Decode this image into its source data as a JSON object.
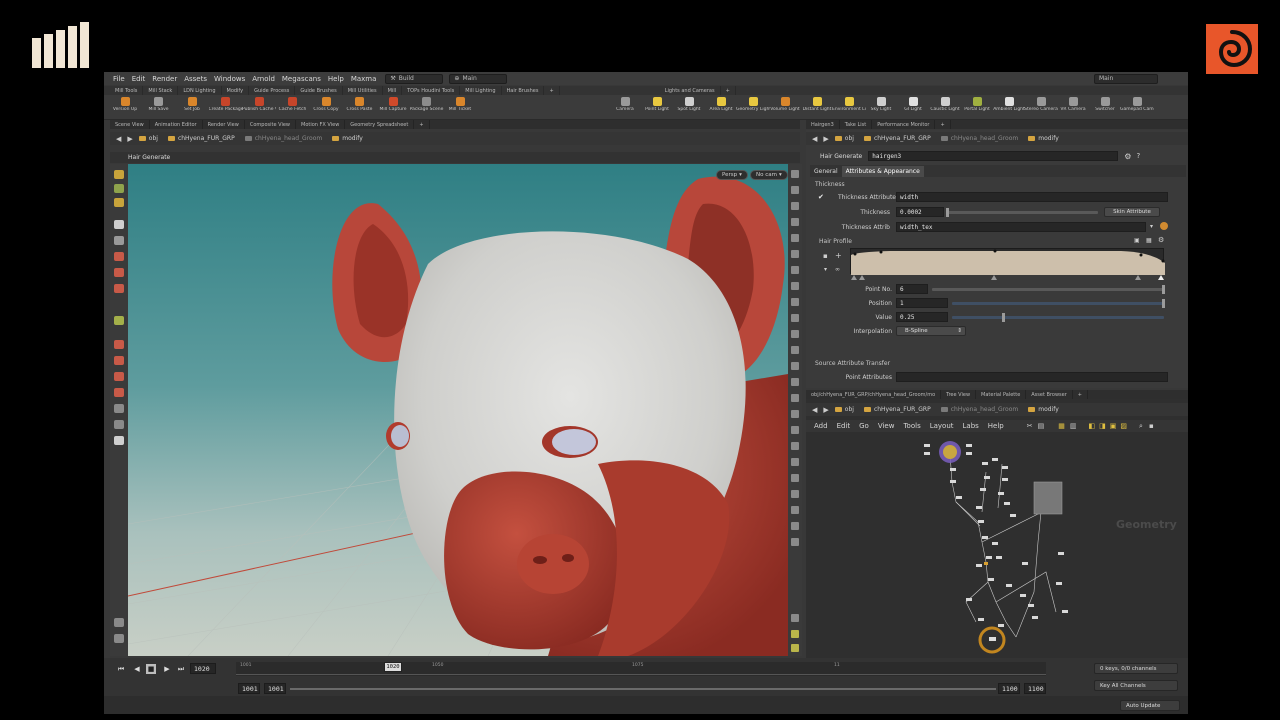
{
  "menubar": {
    "items": [
      "File",
      "Edit",
      "Render",
      "Assets",
      "Windows",
      "Arnold",
      "Megascans",
      "Help",
      "Maxma"
    ],
    "build_label": "Build",
    "desk_label": "Main",
    "right_desk": "Main"
  },
  "shelf_tabs": [
    "Mill Tools",
    "Mill Stack",
    "LDN Lighting",
    "Modify",
    "Guide Process",
    "Guide Brushes",
    "Mill Utilities",
    "Mill",
    "TOPs Houdini Tools",
    "Mill Lighting",
    "Hair Brushes"
  ],
  "lights_tab": "Lights and Cameras",
  "left_tools": [
    {
      "label": "Version Up",
      "color": "#d9862b"
    },
    {
      "label": "Mill Save",
      "color": "#9a9a9a"
    },
    {
      "label": "Set Job",
      "color": "#d9862b"
    },
    {
      "label": "Create Package",
      "color": "#c7452a"
    },
    {
      "label": "Publish Cache Version",
      "color": "#c7452a"
    },
    {
      "label": "Cache Fetch",
      "color": "#c7452a"
    },
    {
      "label": "Cross Copy",
      "color": "#d9862b"
    },
    {
      "label": "Cross Paste",
      "color": "#d9862b"
    },
    {
      "label": "Mill Capture",
      "color": "#d14a2a"
    },
    {
      "label": "Package Scene",
      "color": "#8c8c8c"
    },
    {
      "label": "Mill Ticket",
      "color": "#d9862b"
    }
  ],
  "light_tools": [
    {
      "label": "Camera",
      "color": "#9a9a9a"
    },
    {
      "label": "Point Light",
      "color": "#e8c840"
    },
    {
      "label": "Spot Light",
      "color": "#cfcfcf"
    },
    {
      "label": "Area Light",
      "color": "#e8c840"
    },
    {
      "label": "Geometry Light",
      "color": "#e8c840"
    },
    {
      "label": "Volume Light",
      "color": "#d9862b"
    },
    {
      "label": "Distant Light",
      "color": "#e8c840"
    },
    {
      "label": "Environment Light",
      "color": "#e8c840"
    },
    {
      "label": "Sky Light",
      "color": "#cfcfcf"
    },
    {
      "label": "GI Light",
      "color": "#e0e0e0"
    },
    {
      "label": "Caustic Light",
      "color": "#cfcfcf"
    },
    {
      "label": "Portal Light",
      "color": "#a0b040"
    },
    {
      "label": "Ambient Light",
      "color": "#e0e0e0"
    },
    {
      "label": "Stereo Camera",
      "color": "#9a9a9a"
    },
    {
      "label": "VR Camera",
      "color": "#9a9a9a"
    },
    {
      "label": "Switcher",
      "color": "#9a9a9a"
    },
    {
      "label": "Gamepad Camera",
      "color": "#9a9a9a"
    }
  ],
  "left_pane_tabs": [
    "Scene View",
    "Animation Editor",
    "Render View",
    "Composite View",
    "Motion FX View",
    "Geometry Spreadsheet"
  ],
  "right_pane_tabs": [
    "Hairgen3",
    "Take List",
    "Performance Monitor"
  ],
  "path": {
    "obj": "obj",
    "fur": "chHyena_FUR_GRP",
    "groom": "chHyena_head_Groom",
    "modify": "modify"
  },
  "viewport": {
    "title": "Hair Generate",
    "persp": "Persp",
    "cam": "No cam"
  },
  "params": {
    "node_type": "Hair Generate",
    "node_name": "hairgen3",
    "tabs": [
      "General",
      "Attributes & Appearance"
    ],
    "section_thickness": "Thickness",
    "thickness_attr_label": "Thickness Attribute",
    "thickness_attr_value": "width",
    "thickness_label": "Thickness",
    "thickness_value": "0.0002",
    "skin_attr_btn": "Skin Attribute",
    "thickness_attrib_label": "Thickness Attrib",
    "thickness_attrib_value": "width_tex",
    "hair_profile_label": "Hair Profile",
    "point_no_label": "Point No.",
    "point_no_value": "6",
    "position_label": "Position",
    "position_value": "1",
    "value_label": "Value",
    "value_value": "0.25",
    "interp_label": "Interpolation",
    "interp_value": "B-Spline",
    "source_attr_label": "Source Attribute Transfer",
    "point_attrs_label": "Point Attributes"
  },
  "net_tabs": [
    "obj/chHyena_FUR_GRP/chHyena_head_Groom/mo",
    "Tree View",
    "Material Palette",
    "Asset Browser"
  ],
  "net_menu": [
    "Add",
    "Edit",
    "Go",
    "View",
    "Tools",
    "Layout",
    "Labs",
    "Help"
  ],
  "net_context": "Geometry",
  "timeline": {
    "current_frame": "1020",
    "marker_frame": "1020",
    "ticks": [
      "1001",
      "1020",
      "1050",
      "1075",
      "11"
    ],
    "start": "1001",
    "start2": "1001",
    "end": "1100",
    "end2": "1100",
    "keys": "0 keys, 0/0 channels",
    "key_all": "Key All Channels",
    "auto_update": "Auto Update"
  }
}
